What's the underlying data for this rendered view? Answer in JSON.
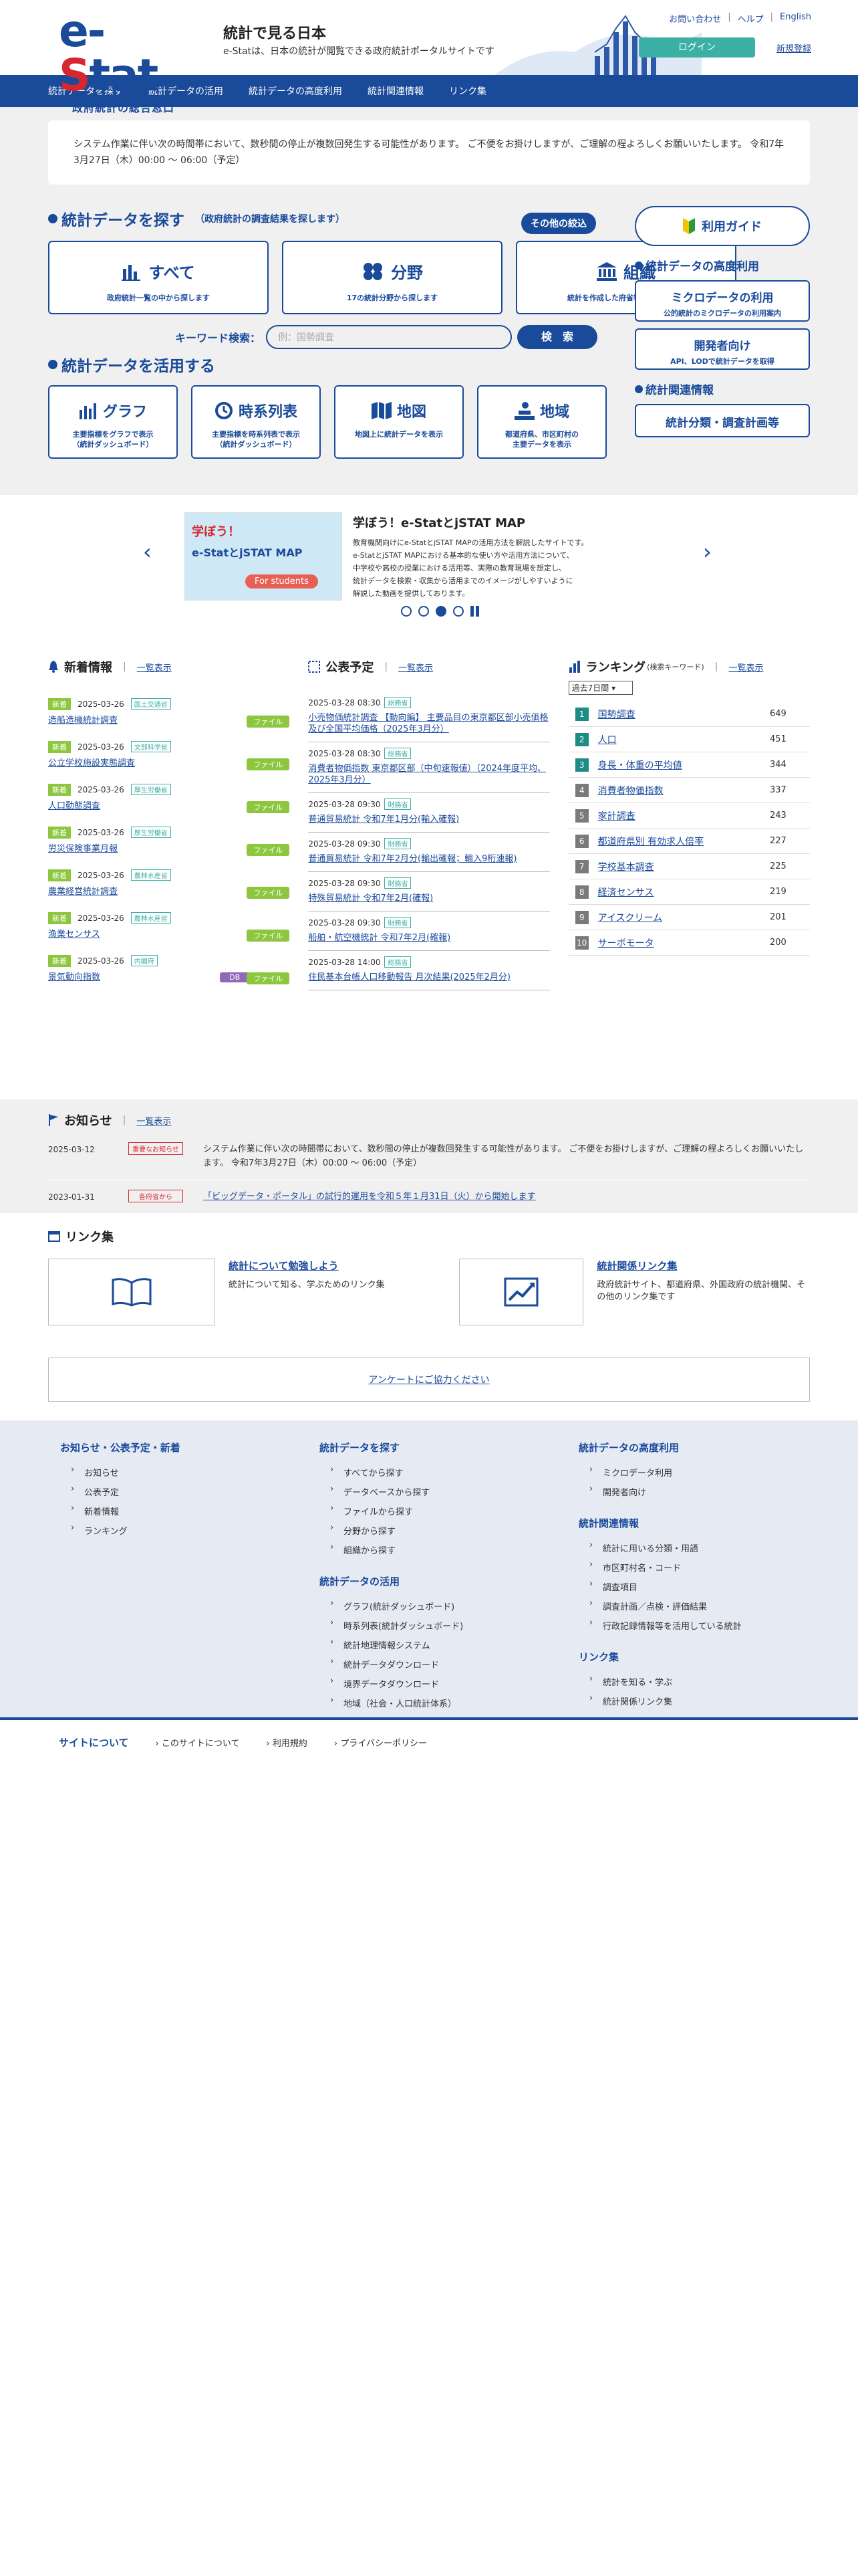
{
  "header": {
    "logo_text": "e-Stat",
    "logo_sub": "政府統計の総合窓口",
    "title": "統計で見る日本",
    "description": "e-Statは、日本の統計が閲覧できる政府統計ポータルサイトです",
    "links": [
      "お問い合わせ",
      "ヘルプ",
      "English"
    ],
    "login": "ログイン",
    "register": "新規登録"
  },
  "gnav": [
    "統計データを探す",
    "統計データの活用",
    "統計データの高度利用",
    "統計関連情報",
    "リンク集"
  ],
  "notice": "システム作業に伴い次の時間帯において、数秒間の停止が複数回発生する可能性があります。 ご不便をお掛けしますが、ご理解の程よろしくお願いいたします。 令和7年3月27日（木）00:00 ～ 06:00（予定）",
  "search": {
    "title": "統計データを探す",
    "subtitle": "（政府統計の調査結果を探します）",
    "filter": "その他の絞込",
    "cards": [
      {
        "title": "すべて",
        "desc": "政府統計一覧の中から探します"
      },
      {
        "title": "分野",
        "desc": "17の統計分野から探します"
      },
      {
        "title": "組織",
        "desc": "統計を作成した府省等から探します"
      }
    ],
    "kw_label": "キーワード検索：",
    "kw_placeholder": "例：国勢調査",
    "kw_button": "検　索"
  },
  "use": {
    "title": "統計データを活用する",
    "cards": [
      {
        "title": "グラフ",
        "desc1": "主要指標をグラフで表示",
        "desc2": "（統計ダッシュボード）"
      },
      {
        "title": "時系列表",
        "desc1": "主要指標を時系列表で表示",
        "desc2": "（統計ダッシュボード）"
      },
      {
        "title": "地図",
        "desc1": "地図上に統計データを表示",
        "desc2": ""
      },
      {
        "title": "地域",
        "desc1": "都道府県、市区町村の",
        "desc2": "主要データを表示"
      }
    ]
  },
  "side": {
    "guide": "利用ガイド",
    "adv_title": "統計データの高度利用",
    "micro": {
      "title": "ミクロデータの利用",
      "desc": "公的統計のミクロデータの利用案内"
    },
    "dev": {
      "title": "開発者向け",
      "desc": "API、LODで統計データを取得"
    },
    "rel_title": "統計関連情報",
    "cls": "統計分類・調査計画等"
  },
  "carousel": {
    "image_text1": "学ぼう！",
    "image_text2": "e-StatとjSTAT MAP",
    "image_text3": "For students",
    "title": "学ぼう！e-StatとjSTAT MAP",
    "lines": [
      "教育機関向けにe-StatとjSTAT MAPの活用方法を解説したサイトです。",
      "e-StatとjSTAT MAPにおける基本的な使い方や活用方法について、",
      "中学校や高校の授業における活用等、実際の教育現場を想定し、",
      "統計データを検索・収集から活用までのイメージがしやすいように",
      "解説した動画を提供しております。"
    ]
  },
  "news": {
    "title": "新着情報",
    "more": "一覧表示",
    "tag": "新着",
    "file": "ファイル",
    "db": "DB",
    "items": [
      {
        "date": "2025-03-26",
        "cat": "国土交通省",
        "title": "造船造機統計調査",
        "db": false
      },
      {
        "date": "2025-03-26",
        "cat": "文部科学省",
        "title": "公立学校施設実態調査",
        "db": false
      },
      {
        "date": "2025-03-26",
        "cat": "厚生労働省",
        "title": "人口動態調査",
        "db": false
      },
      {
        "date": "2025-03-26",
        "cat": "厚生労働省",
        "title": "労災保険事業月報",
        "db": false
      },
      {
        "date": "2025-03-26",
        "cat": "農林水産省",
        "title": "農業経営統計調査",
        "db": false
      },
      {
        "date": "2025-03-26",
        "cat": "農林水産省",
        "title": "漁業センサス",
        "db": false
      },
      {
        "date": "2025-03-26",
        "cat": "内閣府",
        "title": "景気動向指数",
        "db": true
      }
    ]
  },
  "schedule": {
    "title": "公表予定",
    "more": "一覧表示",
    "items": [
      {
        "date": "2025-03-28 08:30",
        "cat": "総務省",
        "title": "小売物価統計調査 【動向編】 主要品目の東京都区部小売価格及び全国平均価格（2025年3月分）"
      },
      {
        "date": "2025-03-28 08:30",
        "cat": "総務省",
        "title": "消費者物価指数 東京都区部（中旬速報値）（2024年度平均、2025年3月分）"
      },
      {
        "date": "2025-03-28 09:30",
        "cat": "財務省",
        "title": "普通貿易統計 令和7年1月分(輸入確報)"
      },
      {
        "date": "2025-03-28 09:30",
        "cat": "財務省",
        "title": "普通貿易統計 令和7年2月分(輸出確報；輸入9桁速報)"
      },
      {
        "date": "2025-03-28 09:30",
        "cat": "財務省",
        "title": "特殊貿易統計 令和7年2月(確報)"
      },
      {
        "date": "2025-03-28 09:30",
        "cat": "財務省",
        "title": "船舶・航空機統計 令和7年2月(確報)"
      },
      {
        "date": "2025-03-28 14:00",
        "cat": "総務省",
        "title": "住民基本台帳人口移動報告 月次結果(2025年2月分)"
      }
    ]
  },
  "ranking": {
    "title": "ランキング",
    "subtitle": "(検索キーワード)",
    "more": "一覧表示",
    "period": "過去7日間",
    "items": [
      {
        "no": "1",
        "name": "国勢調査",
        "count": "649"
      },
      {
        "no": "2",
        "name": "人口",
        "count": "451"
      },
      {
        "no": "3",
        "name": "身長・体重の平均値",
        "count": "344"
      },
      {
        "no": "4",
        "name": "消費者物価指数",
        "count": "337"
      },
      {
        "no": "5",
        "name": "家計調査",
        "count": "243"
      },
      {
        "no": "6",
        "name": "都道府県別 有効求人倍率",
        "count": "227"
      },
      {
        "no": "7",
        "name": "学校基本調査",
        "count": "225"
      },
      {
        "no": "8",
        "name": "経済センサス",
        "count": "219"
      },
      {
        "no": "9",
        "name": "アイスクリーム",
        "count": "201"
      },
      {
        "no": "10",
        "name": "サーボモータ",
        "count": "200"
      }
    ]
  },
  "oshirase": {
    "title": "お知らせ",
    "more": "一覧表示",
    "items": [
      {
        "date": "2025-03-12",
        "tag": "重要なお知らせ",
        "text": "システム作業に伴い次の時間帯において、数秒間の停止が複数回発生する可能性があります。 ご不便をお掛けしますが、ご理解の程よろしくお願いいたします。 令和7年3月27日（木）00:00 ～ 06:00（予定）"
      },
      {
        "date": "2023-01-31",
        "tag": "各府省から",
        "text": "「ビッグデータ・ポータル」の試行的運用を令和５年１月31日（火）から開始します"
      }
    ]
  },
  "links": {
    "title": "リンク集",
    "cards": [
      {
        "title": "統計について勉強しよう",
        "desc": "統計について知る、学ぶためのリンク集"
      },
      {
        "title": "統計関係リンク集",
        "desc": "政府統計サイト、都道府県、外国政府の統計機関、その他のリンク集です"
      }
    ],
    "survey": "アンケートにご協力ください"
  },
  "sitemap": {
    "col1": {
      "title": "お知らせ・公表予定・新着",
      "items": [
        "お知らせ",
        "公表予定",
        "新着情報",
        "ランキング"
      ]
    },
    "col2a": {
      "title": "統計データを探す",
      "items": [
        "すべてから探す",
        "データベースから探す",
        "ファイルから探す",
        "分野から探す",
        "組織から探す"
      ]
    },
    "col2b": {
      "title": "統計データの活用",
      "items": [
        "グラフ(統計ダッシュボード)",
        "時系列表(統計ダッシュボード)",
        "統計地理情報システム",
        "統計データダウンロード",
        "境界データダウンロード",
        "地域（社会・人口統計体系）"
      ]
    },
    "col3a": {
      "title": "統計データの高度利用",
      "items": [
        "ミクロデータ利用",
        "開発者向け"
      ]
    },
    "col3b": {
      "title": "統計関連情報",
      "items": [
        "統計に用いる分類・用語",
        "市区町村名・コード",
        "調査項目",
        "調査計画／点検・評価結果",
        "行政記録情報等を活用している統計"
      ]
    },
    "col3c": {
      "title": "リンク集",
      "items": [
        "統計を知る・学ぶ",
        "統計関係リンク集"
      ]
    }
  },
  "about": {
    "title": "サイトについて",
    "items": [
      "このサイトについて",
      "利用規約",
      "プライバシーポリシー"
    ]
  },
  "colors": {
    "primary": "#1a4a9a",
    "accent_red": "#d8262f",
    "teal": "#3db0a6",
    "new_green": "#8dc63f"
  }
}
